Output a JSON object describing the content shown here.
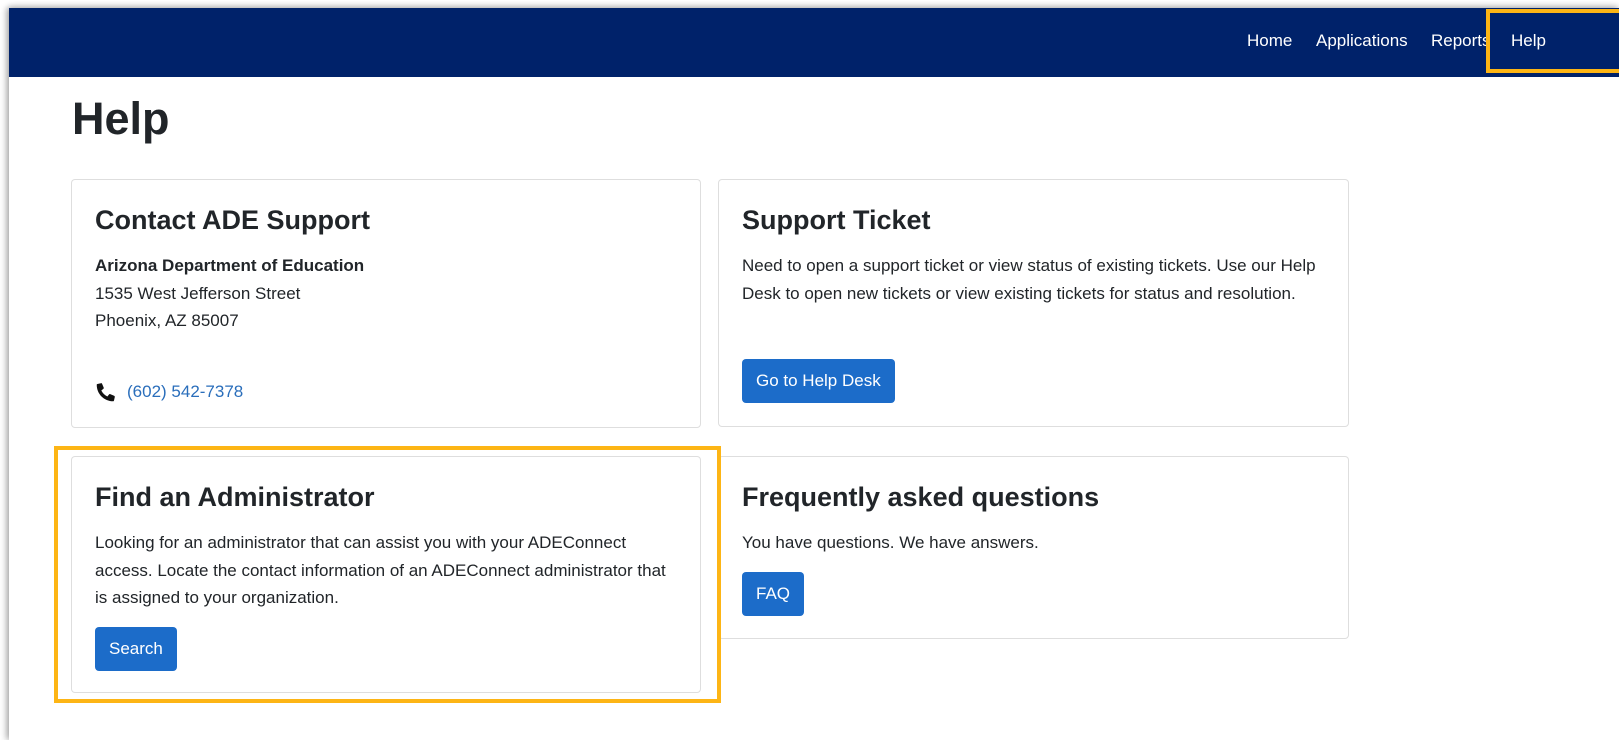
{
  "nav": {
    "items": [
      {
        "label": "Home"
      },
      {
        "label": "Applications"
      },
      {
        "label": "Reports"
      },
      {
        "label": "Help"
      }
    ]
  },
  "page": {
    "title": "Help"
  },
  "cards": {
    "contact": {
      "title": "Contact ADE Support",
      "org_name": "Arizona Department of Education",
      "address_line1": "1535 West Jefferson Street",
      "address_line2": "Phoenix, AZ 85007",
      "phone_icon": "phone-icon",
      "phone": "(602) 542-7378"
    },
    "ticket": {
      "title": "Support Ticket",
      "description": "Need to open a support ticket or view status of existing tickets. Use our Help Desk to open new tickets or view existing tickets for status and resolution.",
      "button_label": "Go to Help Desk"
    },
    "admin": {
      "title": "Find an Administrator",
      "description": "Looking for an administrator that can assist you with your ADEConnect access. Locate the contact information of an ADEConnect administrator that is assigned to your organization.",
      "button_label": "Search"
    },
    "faq": {
      "title": "Frequently asked questions",
      "description": "You have questions. We have answers.",
      "button_label": "FAQ"
    }
  },
  "colors": {
    "navbar_bg": "#00226a",
    "button_bg": "#1c6cc9",
    "link": "#2a6ebb",
    "highlight": "#fdb515"
  }
}
